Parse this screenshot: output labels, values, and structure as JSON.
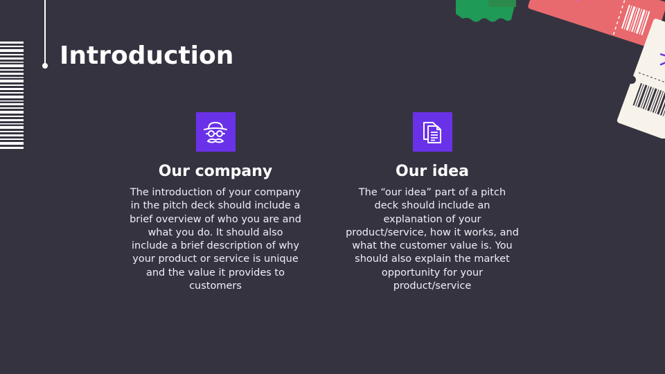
{
  "slide": {
    "title": "Introduction",
    "colors": {
      "background": "#363340",
      "accent": "#6a32e8",
      "text": "#ffffff",
      "ticket_red": "#e96a6e",
      "ticket_green": "#1f9a57",
      "ticket_cream": "#f7f3ea"
    }
  },
  "columns": [
    {
      "icon": "disguise-icon",
      "heading": "Our company",
      "body": "The introduction of your company in the pitch deck should include a brief overview of who you are and what you do. It should also include a brief description of why your product or service is unique and the value it provides to customers"
    },
    {
      "icon": "documents-icon",
      "heading": "Our idea",
      "body": "The “our idea” part of a pitch deck should include an explanation of your product/service, how it works, and what the customer value is. You should also explain the market opportunity for your product/service"
    }
  ]
}
